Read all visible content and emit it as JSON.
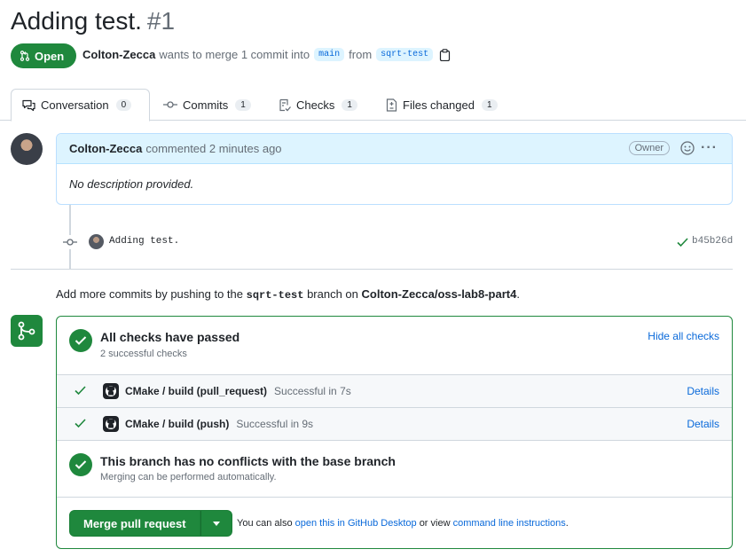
{
  "pr": {
    "title": "Adding test.",
    "number": "#1",
    "state": "Open",
    "author": "Colton-Zecca",
    "merge_text": "wants to merge 1 commit into",
    "base_branch": "main",
    "from_text": "from",
    "head_branch": "sqrt-test"
  },
  "tabs": [
    {
      "label": "Conversation",
      "count": "0",
      "icon": "comment-discussion-icon"
    },
    {
      "label": "Commits",
      "count": "1",
      "icon": "git-commit-icon"
    },
    {
      "label": "Checks",
      "count": "1",
      "icon": "checklist-icon"
    },
    {
      "label": "Files changed",
      "count": "1",
      "icon": "file-diff-icon"
    }
  ],
  "comment": {
    "author": "Colton-Zecca",
    "meta": "commented 2 minutes ago",
    "badge": "Owner",
    "body": "No description provided."
  },
  "commit": {
    "message": "Adding test.",
    "sha": "b45b26d"
  },
  "push_hint": {
    "prefix": "Add more commits by pushing to the",
    "branch": "sqrt-test",
    "middle": "branch on",
    "repo": "Colton-Zecca/oss-lab8-part4",
    "suffix": "."
  },
  "checks": {
    "title": "All checks have passed",
    "subtitle": "2 successful checks",
    "hide_label": "Hide all checks",
    "items": [
      {
        "name": "CMake / build (pull_request)",
        "status": "Successful in 7s",
        "details": "Details"
      },
      {
        "name": "CMake / build (push)",
        "status": "Successful in 9s",
        "details": "Details"
      }
    ]
  },
  "conflicts": {
    "title": "This branch has no conflicts with the base branch",
    "subtitle": "Merging can be performed automatically."
  },
  "merge": {
    "button": "Merge pull request",
    "alt_prefix": "You can also",
    "desktop_link": "open this in GitHub Desktop",
    "alt_middle": "or view",
    "cli_link": "command line instructions",
    "alt_suffix": "."
  },
  "colors": {
    "success": "#1f883d",
    "link": "#0969da",
    "muted": "#656d76",
    "header_blue": "#ddf4ff"
  }
}
